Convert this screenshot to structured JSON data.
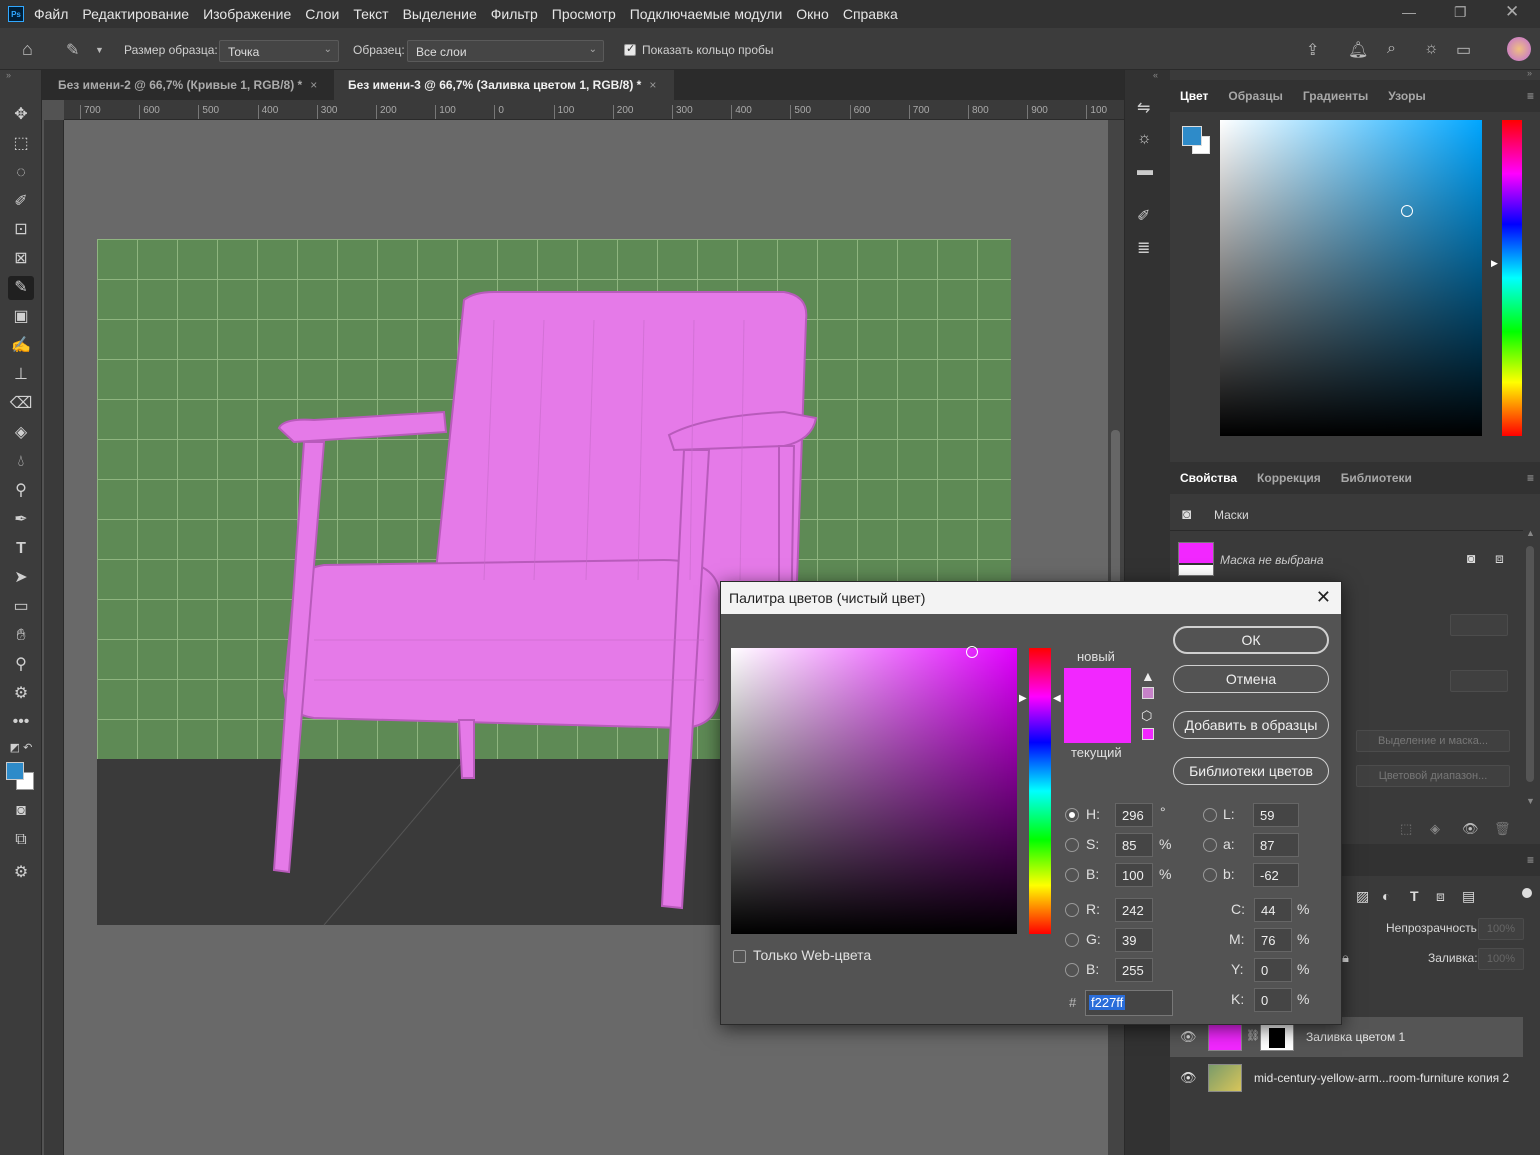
{
  "app": {
    "logo": "Ps"
  },
  "menu": [
    "Файл",
    "Редактирование",
    "Изображение",
    "Слои",
    "Текст",
    "Выделение",
    "Фильтр",
    "Просмотр",
    "Подключаемые модули",
    "Окно",
    "Справка"
  ],
  "options": {
    "sample_size_label": "Размер образца:",
    "sample_size_value": "Точка",
    "sample_label": "Образец:",
    "sample_value": "Все слои",
    "show_ring_label": "Показать кольцо пробы"
  },
  "doc_tabs": [
    {
      "title": "Без имени-2 @ 66,7% (Кривые 1, RGB/8) *",
      "active": false
    },
    {
      "title": "Без имени-3 @ 66,7% (Заливка цветом 1, RGB/8) *",
      "active": true
    }
  ],
  "ruler_top": [
    "700",
    "600",
    "500",
    "400",
    "300",
    "200",
    "100",
    "0",
    "100",
    "200",
    "300",
    "400",
    "500",
    "600",
    "700",
    "800",
    "900",
    "100"
  ],
  "color_panel": {
    "tabs": [
      "Цвет",
      "Образцы",
      "Градиенты",
      "Узоры"
    ],
    "foreground_color": "#2e8bc9",
    "background_color": "#ffffff"
  },
  "properties_panel": {
    "tabs": [
      "Свойства",
      "Коррекция",
      "Библиотеки"
    ],
    "section_label": "Маски",
    "mask_status": "Маска не выбрана",
    "select_and_mask": "Выделение и маска...",
    "color_range": "Цветовой диапазон..."
  },
  "layers_panel": {
    "opacity_label": "Непрозрачность:",
    "opacity_value": "100%",
    "fill_label": "Заливка:",
    "fill_value": "100%",
    "layers": [
      {
        "name": "Заливка цветом 1",
        "selected": true
      },
      {
        "name": "mid-century-yellow-arm...room-furniture копия 2",
        "selected": false
      }
    ]
  },
  "dialog": {
    "title": "Палитра цветов (чистый цвет)",
    "new_label": "новый",
    "current_label": "текущий",
    "new_color": "#f227ff",
    "current_color": "#f227ff",
    "buttons": {
      "ok": "ОК",
      "cancel": "Отмена",
      "add_swatch": "Добавить в образцы",
      "libraries": "Библиотеки цветов"
    },
    "web_only_label": "Только Web-цвета",
    "hsb": {
      "h_label": "H:",
      "h": "296",
      "h_unit": "°",
      "s_label": "S:",
      "s": "85",
      "s_unit": "%",
      "b_label": "B:",
      "b": "100",
      "b_unit": "%"
    },
    "rgb": {
      "r_label": "R:",
      "r": "242",
      "g_label": "G:",
      "g": "39",
      "b_label": "B:",
      "b": "255"
    },
    "lab": {
      "l_label": "L:",
      "l": "59",
      "a_label": "a:",
      "a": "87",
      "b_label": "b:",
      "b": "-62"
    },
    "cmyk": {
      "c_label": "C:",
      "c": "44",
      "m_label": "M:",
      "m": "76",
      "y_label": "Y:",
      "y": "0",
      "k_label": "K:",
      "k": "0",
      "unit": "%"
    },
    "hex_label": "#",
    "hex": "f227ff"
  }
}
